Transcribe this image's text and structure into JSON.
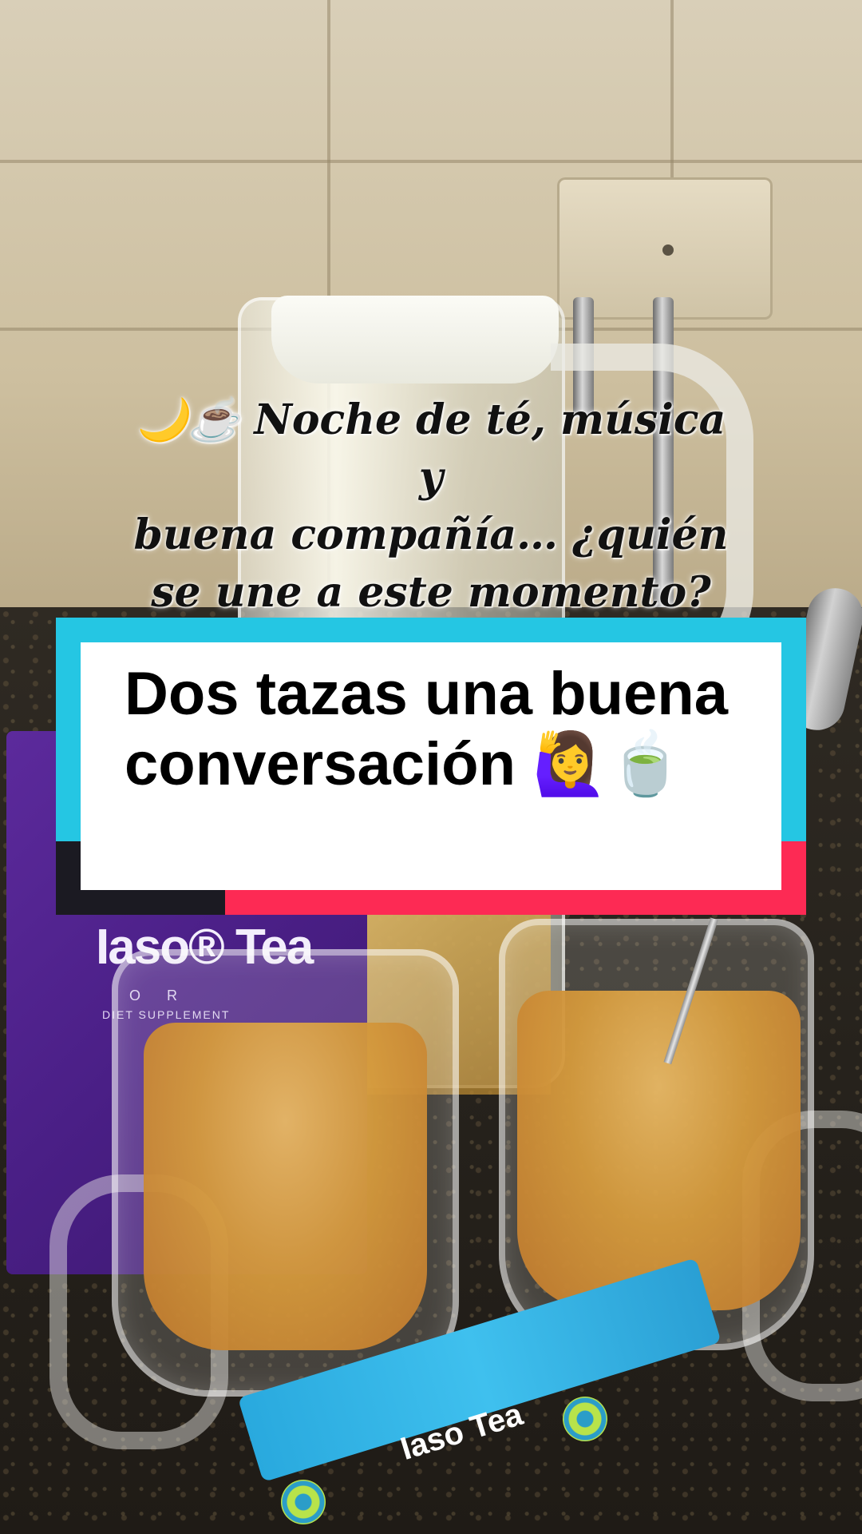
{
  "overlay": {
    "caption_line1": "🌙☕ Noche de té, música y",
    "caption_line2": "buena compañía… ¿quién",
    "caption_line3": "se une a este momento? 💜",
    "caption_line4": "👇"
  },
  "text_card": {
    "line1": "Dos tazas una buena",
    "line2": "conversación 🙋‍♀️🍵"
  },
  "products": {
    "purple_pack_brand": "Iaso® Tea",
    "purple_pack_sub1": "O R",
    "purple_pack_sub2": "DIET  SUPPLEMENT",
    "blue_stick_brand": "Iaso Tea"
  },
  "colors": {
    "card_cyan": "#25c6e3",
    "card_red": "#fd2a54",
    "card_dark": "#1b1a22",
    "pack_purple": "#4a1f86",
    "stick_blue": "#3fc0ee"
  }
}
